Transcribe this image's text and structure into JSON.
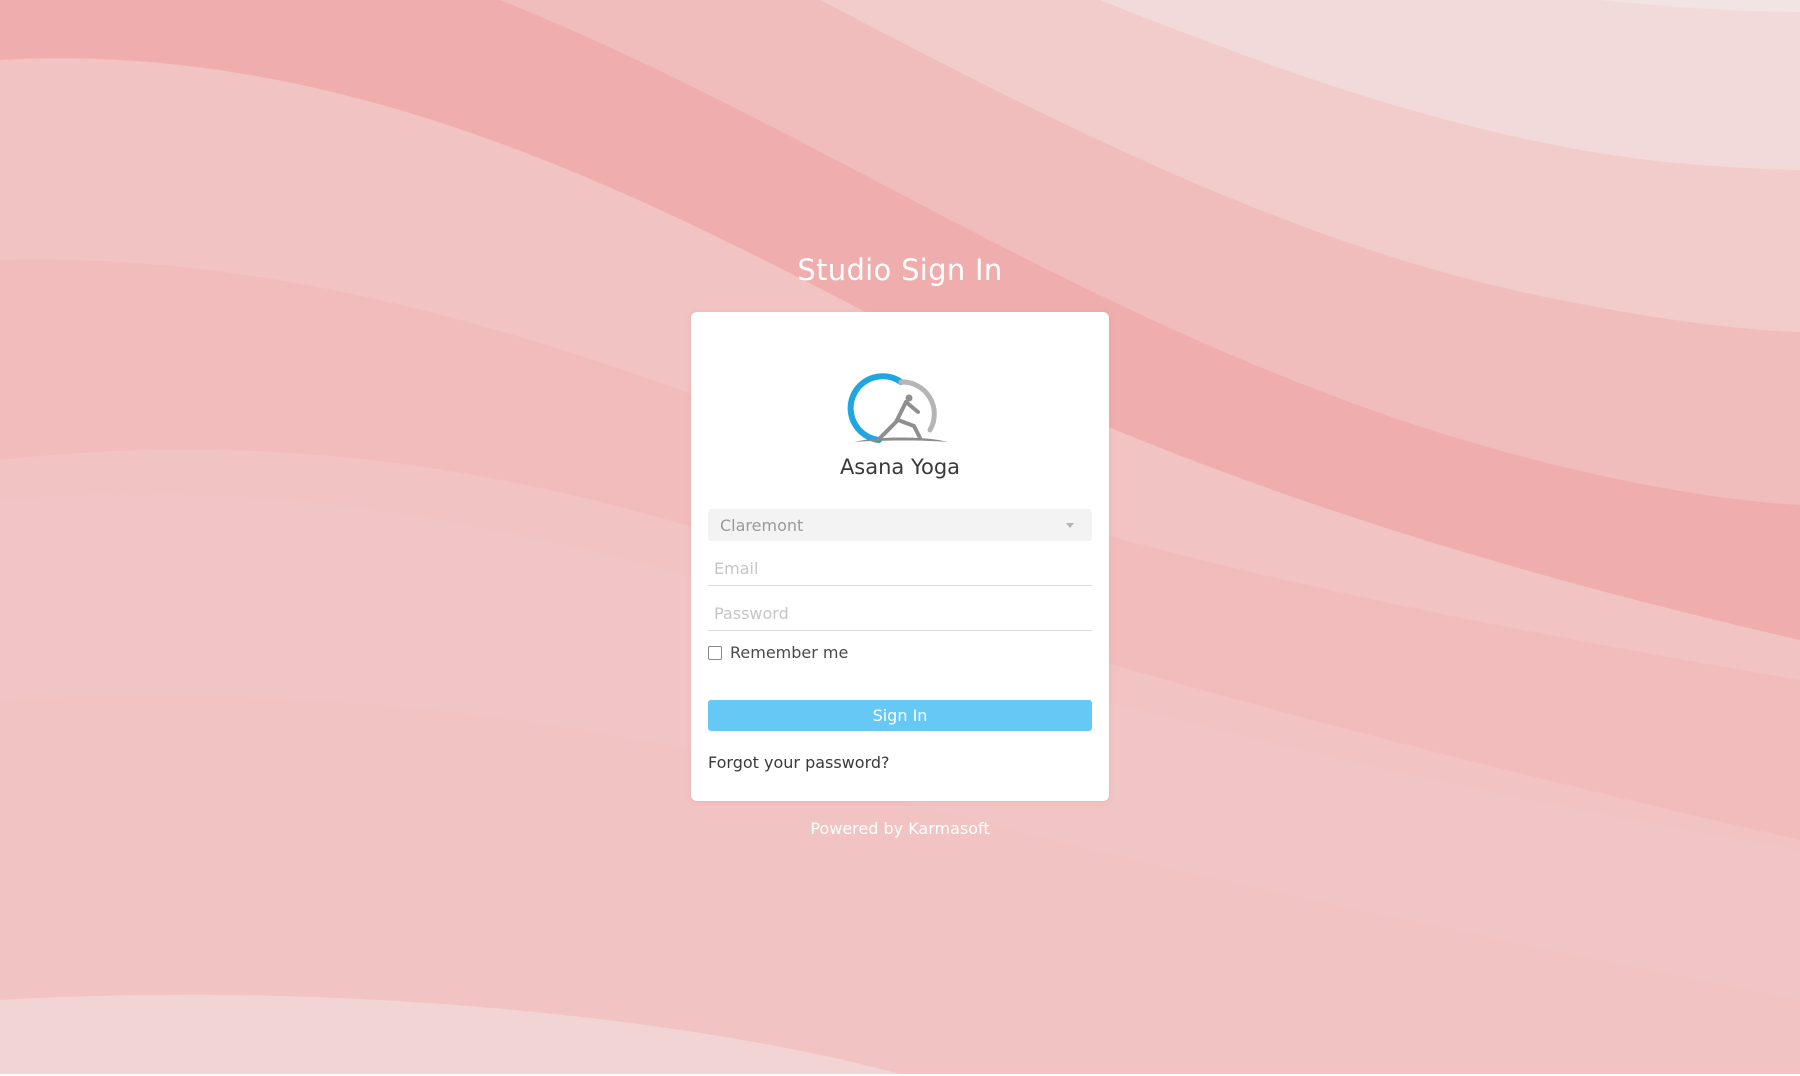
{
  "page": {
    "title": "Studio Sign In",
    "background_colors": [
      "#f0aaaa",
      "#f2b9b9",
      "#f2c6c6",
      "#f3d6d6",
      "#f1e4e3"
    ]
  },
  "studio": {
    "name": "Asana Yoga",
    "logo_icon": "yoga-pose-logo"
  },
  "form": {
    "location_value": "Claremont",
    "email_placeholder": "Email",
    "password_placeholder": "Password",
    "remember_label": "Remember me",
    "remember_checked": false,
    "signin_label": "Sign In",
    "forgot_label": "Forgot your password?"
  },
  "footer": {
    "powered_prefix": "Powered by",
    "powered_brand": "Karmasoft"
  },
  "colors": {
    "accent_button": "#66c8f4",
    "logo_blue": "#1fa6e0",
    "logo_gray": "#9e9e9e"
  }
}
